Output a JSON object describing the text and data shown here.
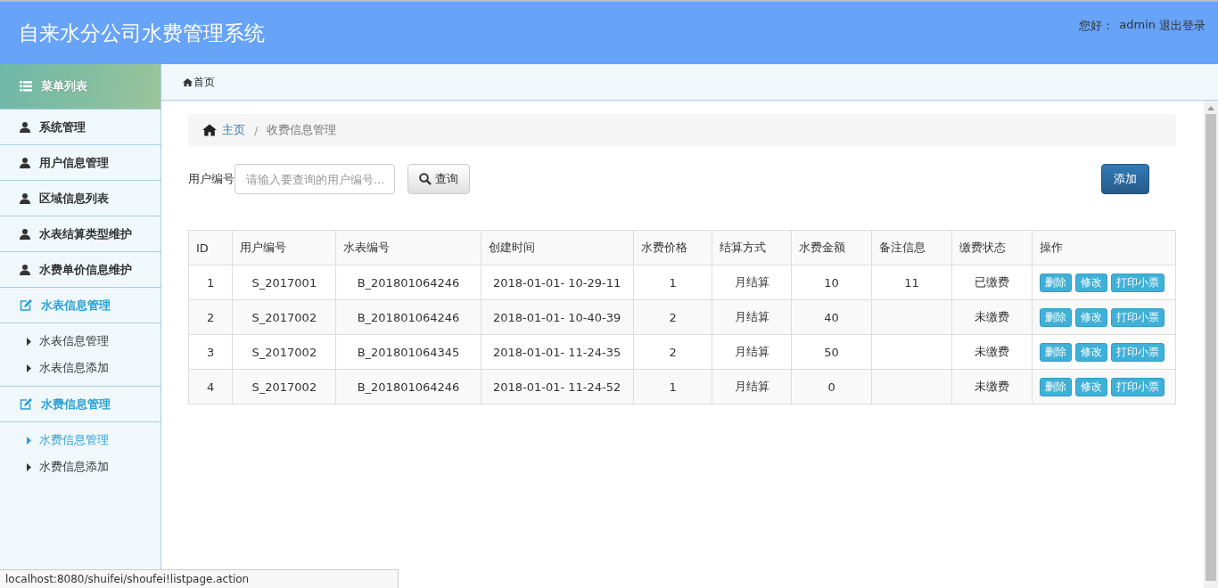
{
  "header": {
    "title": "自来水分公司水费管理系统",
    "greeting": "您好：",
    "user": "admin",
    "logout": "退出登录"
  },
  "sidebar": {
    "title": "菜单列表",
    "items": [
      {
        "kind": "item",
        "label": "系统管理"
      },
      {
        "kind": "item",
        "label": "用户信息管理"
      },
      {
        "kind": "item",
        "label": "区域信息列表"
      },
      {
        "kind": "item",
        "label": "水表结算类型维护"
      },
      {
        "kind": "item",
        "label": "水费单价信息维护"
      },
      {
        "kind": "group",
        "label": "水表信息管理",
        "children": [
          {
            "label": "水表信息管理",
            "selected": false
          },
          {
            "label": "水表信息添加",
            "selected": false
          }
        ]
      },
      {
        "kind": "group",
        "label": "水费信息管理",
        "children": [
          {
            "label": "水费信息管理",
            "selected": true
          },
          {
            "label": "水费信息添加",
            "selected": false
          }
        ]
      }
    ]
  },
  "tabs": [
    {
      "label": "首页",
      "selected": true
    }
  ],
  "breadcrumb": {
    "home": "主页",
    "separator": "/",
    "current": "收费信息管理"
  },
  "search": {
    "label": "用户编号",
    "placeholder": "请输入要查询的用户编号...",
    "button": "查询"
  },
  "add_button": "添加",
  "table": {
    "columns": [
      "ID",
      "用户编号",
      "水表编号",
      "创建时间",
      "水费价格",
      "结算方式",
      "水费金额",
      "备注信息",
      "缴费状态",
      "操作"
    ],
    "rows": [
      {
        "cells": [
          "1",
          "S_2017001",
          "B_201801064246",
          "2018-01-01- 10-29-11",
          "1",
          "月结算",
          "10",
          "11",
          "已缴费"
        ],
        "actions": [
          "删除",
          "修改",
          "打印小票"
        ]
      },
      {
        "cells": [
          "2",
          "S_2017002",
          "B_201801064246",
          "2018-01-01- 10-40-39",
          "2",
          "月结算",
          "40",
          "",
          "未缴费"
        ],
        "actions": [
          "删除",
          "修改",
          "打印小票"
        ]
      },
      {
        "cells": [
          "3",
          "S_2017002",
          "B_201801064345",
          "2018-01-01- 11-24-35",
          "2",
          "月结算",
          "50",
          "",
          "未缴费"
        ],
        "actions": [
          "删除",
          "修改",
          "打印小票"
        ]
      },
      {
        "cells": [
          "4",
          "S_2017002",
          "B_201801064246",
          "2018-01-01- 11-24-52",
          "1",
          "月结算",
          "0",
          "",
          "未缴费"
        ],
        "actions": [
          "删除",
          "修改",
          "打印小票"
        ]
      }
    ]
  },
  "status_bar": {
    "url": "localhost:8080/shuifei/shoufei!listpage.action"
  }
}
